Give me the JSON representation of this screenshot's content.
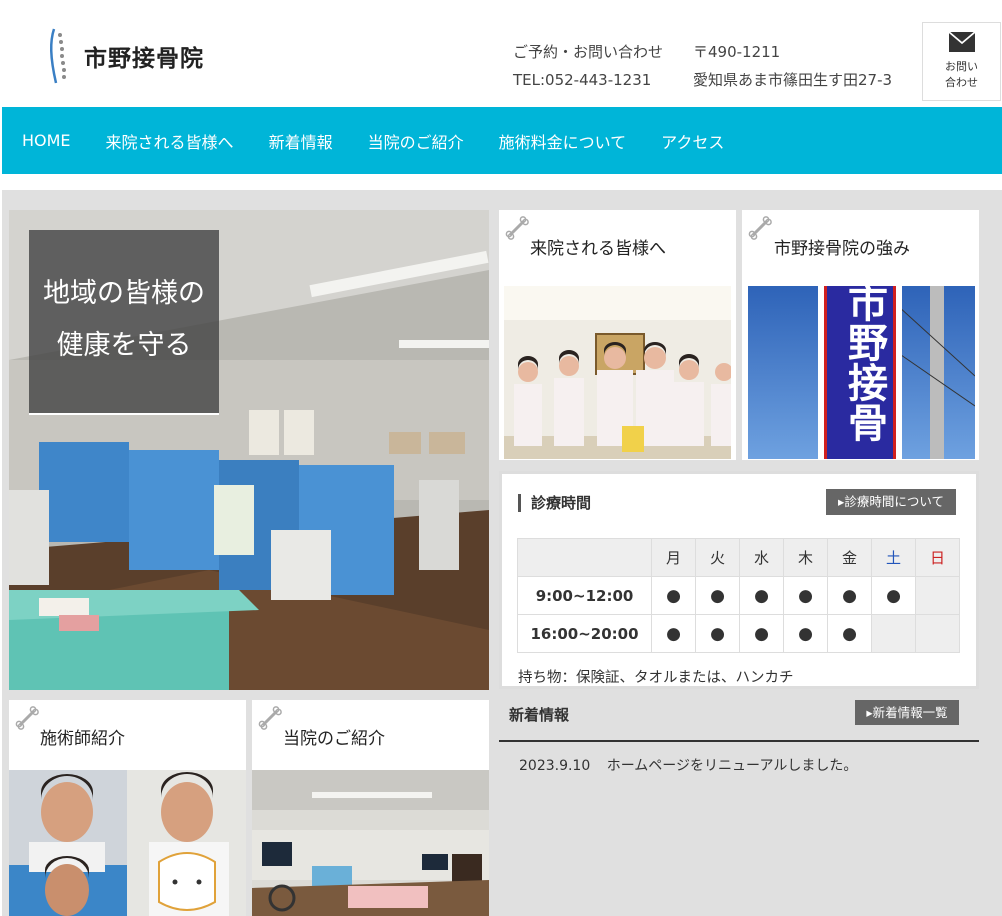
{
  "header": {
    "logo_text": "市野接骨院",
    "contact_label": "ご予約・お問い合わせ",
    "postal": "〒490-1211",
    "tel": "TEL:052-443-1231",
    "address": "愛知県あま市篠田生す田27-3",
    "mail_label_1": "お問い",
    "mail_label_2": "合わせ"
  },
  "nav": {
    "items": [
      "HOME",
      "来院される皆様へ",
      "新着情報",
      "当院のご紹介",
      "施術料金について",
      "アクセス"
    ]
  },
  "hero": {
    "line1": "地域の皆様の",
    "line2": "健康を守る"
  },
  "cards": {
    "visitors": "来院される皆様へ",
    "strength": "市野接骨院の強み",
    "staff": "施術師紹介",
    "about": "当院のご紹介"
  },
  "schedule": {
    "title": "診療時間",
    "link": "▸診療時間について",
    "days": [
      "月",
      "火",
      "水",
      "木",
      "金",
      "土",
      "日"
    ],
    "rows": [
      {
        "time": "9:00~12:00",
        "cells": [
          "●",
          "●",
          "●",
          "●",
          "●",
          "●",
          ""
        ]
      },
      {
        "time": "16:00~20:00",
        "cells": [
          "●",
          "●",
          "●",
          "●",
          "●",
          "",
          ""
        ]
      }
    ],
    "note": "持ち物：保険証、タオルまたは、ハンカチ"
  },
  "news": {
    "title": "新着情報",
    "link": "▸新着情報一覧",
    "items": [
      {
        "date": "2023.9.10",
        "text": "ホームページをリニューアルしました。"
      }
    ]
  },
  "sign_text": "市野接骨",
  "colors": {
    "nav": "#00b5d8",
    "saturday": "#2255bb",
    "sunday": "#cc2222"
  }
}
